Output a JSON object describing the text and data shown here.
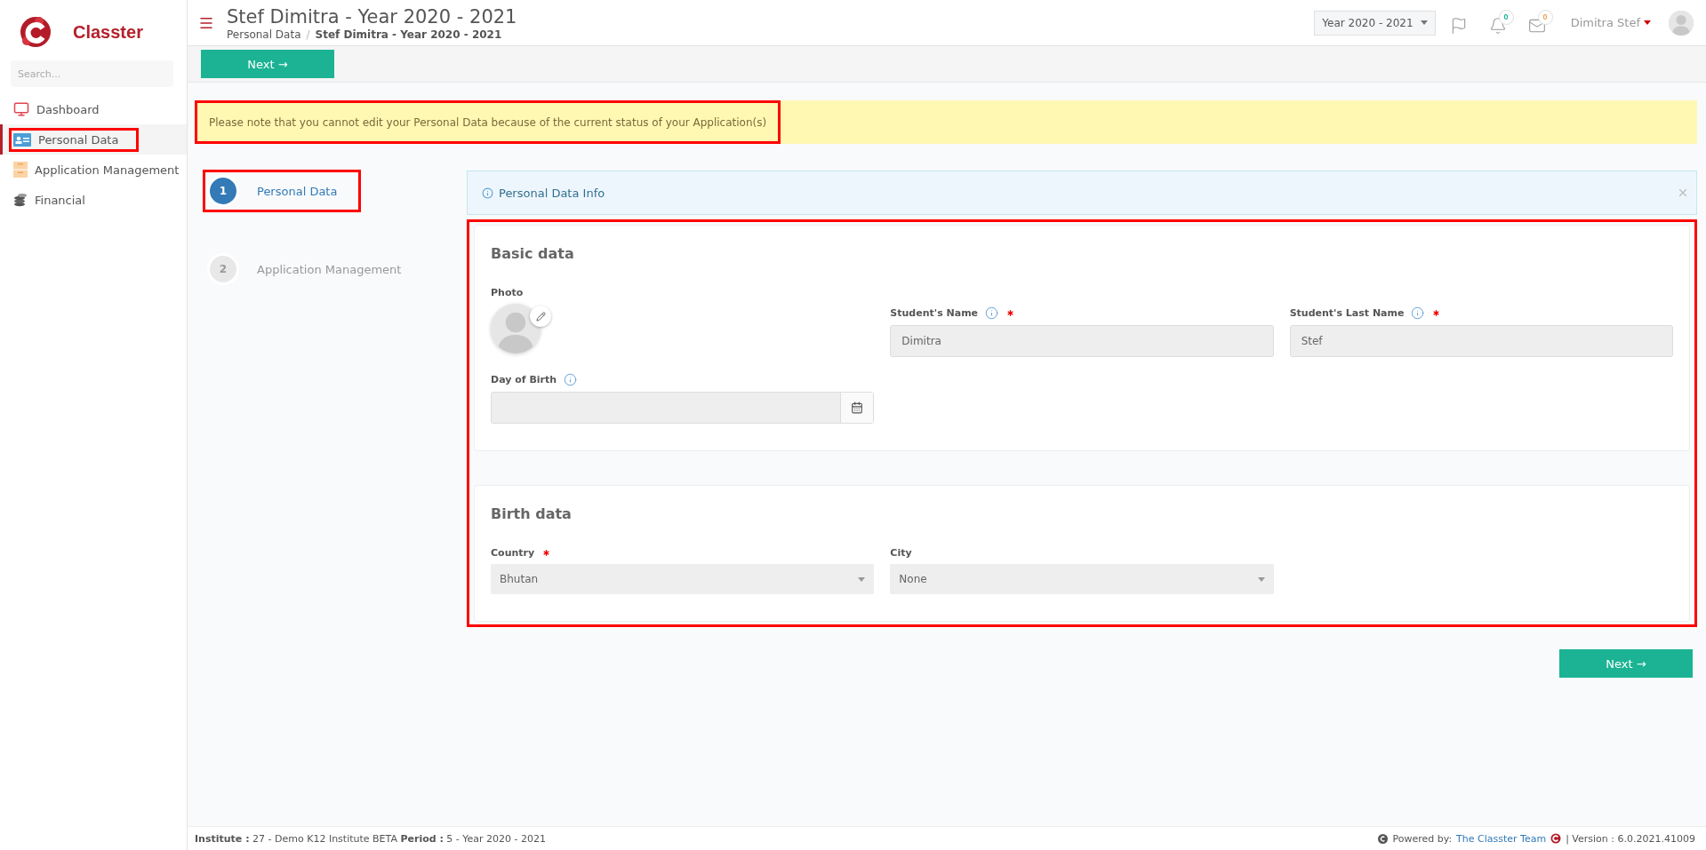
{
  "sidebar": {
    "logo": "Classter",
    "search": {
      "placeholder": "Search..."
    },
    "items": [
      {
        "label": "Dashboard",
        "selected": false,
        "highlighted": false
      },
      {
        "label": "Personal Data",
        "selected": true,
        "highlighted": true
      },
      {
        "label": "Application Management",
        "selected": false,
        "highlighted": false
      },
      {
        "label": "Financial",
        "selected": false,
        "highlighted": false
      }
    ]
  },
  "header": {
    "title": "Stef Dimitra - Year 2020 - 2021",
    "breadcrumb": [
      "Personal Data",
      "Stef Dimitra - Year 2020 - 2021"
    ],
    "breadcrumb_separator": "/",
    "year_select": "Year 2020 - 2021",
    "notifications": "0",
    "messages": "0",
    "user": "Dimitra Stef"
  },
  "toolbar": {
    "next_button": "Next →"
  },
  "notice": {
    "text": "Please note that you cannot edit your Personal Data because of the current status of your Application(s)",
    "highlighted": true
  },
  "steps": [
    {
      "number": "1",
      "label": "Personal Data",
      "selected": true,
      "highlighted": true
    },
    {
      "number": "2",
      "label": "Application Management",
      "selected": false,
      "highlighted": false
    }
  ],
  "info_box": {
    "text": "Personal Data Info"
  },
  "form": {
    "highlighted": true,
    "sections": [
      {
        "title": "Basic data",
        "fields": [
          {
            "kind": "photo",
            "label": "Photo"
          },
          {
            "kind": "text",
            "label": "Student's Name",
            "required": true,
            "info": true,
            "value": "Dimitra"
          },
          {
            "kind": "text",
            "label": "Student's Last Name",
            "required": true,
            "info": true,
            "value": "Stef"
          },
          {
            "kind": "date",
            "label": "Day of Birth",
            "info": true
          }
        ]
      },
      {
        "title": "Birth data",
        "fields": [
          {
            "kind": "select",
            "label": "Country",
            "required": true,
            "value": "Bhutan"
          },
          {
            "kind": "select",
            "label": "City",
            "value": "None"
          }
        ]
      }
    ]
  },
  "bottom_next_button": "Next →",
  "footer": {
    "institute": "**Institute :** 27 - Demo K12 Institute BETA **Period :** 5 - Year 2020 - 2021",
    "powered_by": "Powered by:",
    "team_link": "The Classter Team",
    "version": "| Version : 6.0.2021.41009"
  }
}
